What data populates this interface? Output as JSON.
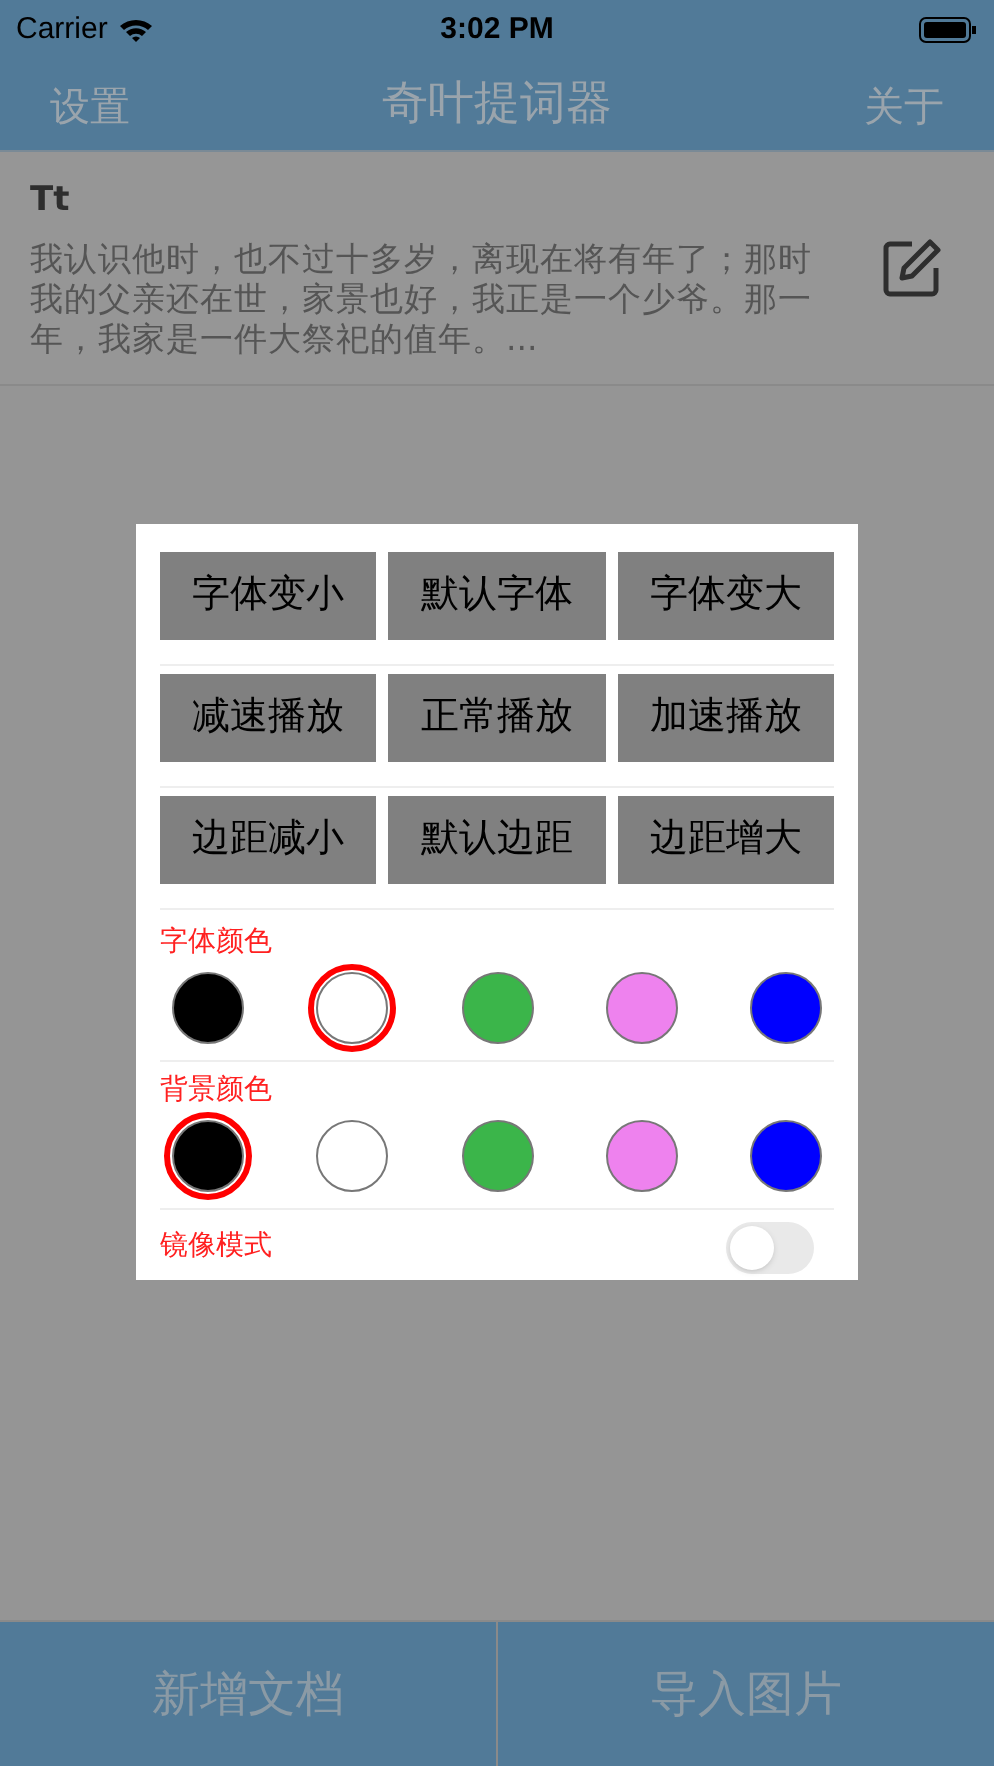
{
  "status_bar": {
    "carrier": "Carrier",
    "time": "3:02 PM"
  },
  "nav": {
    "left": "设置",
    "title": "奇叶提词器",
    "right": "关于"
  },
  "documents": [
    {
      "title": "Tt",
      "preview": "我认识他时，也不过十多岁，离现在将有年了；那时我的父亲还在世，家景也好，我正是一个少爷。那一年，我家是一件大祭祀的值年。..."
    }
  ],
  "dialog": {
    "button_rows": [
      [
        "字体变小",
        "默认字体",
        "字体变大"
      ],
      [
        "减速播放",
        "正常播放",
        "加速播放"
      ],
      [
        "边距减小",
        "默认边距",
        "边距增大"
      ]
    ],
    "color_groups": [
      {
        "label": "字体颜色",
        "swatches": [
          {
            "color": "#000000",
            "selected": false
          },
          {
            "color": "#ffffff",
            "selected": true
          },
          {
            "color": "#3bb54a",
            "selected": false
          },
          {
            "color": "#ee82ee",
            "selected": false
          },
          {
            "color": "#0000ff",
            "selected": false
          }
        ]
      },
      {
        "label": "背景颜色",
        "swatches": [
          {
            "color": "#000000",
            "selected": true
          },
          {
            "color": "#ffffff",
            "selected": false
          },
          {
            "color": "#3bb54a",
            "selected": false
          },
          {
            "color": "#ee82ee",
            "selected": false
          },
          {
            "color": "#0000ff",
            "selected": false
          }
        ]
      }
    ],
    "mirror_mode": {
      "label": "镜像模式",
      "on": false
    }
  },
  "bottom_buttons": [
    "新增文档",
    "导入图片"
  ]
}
